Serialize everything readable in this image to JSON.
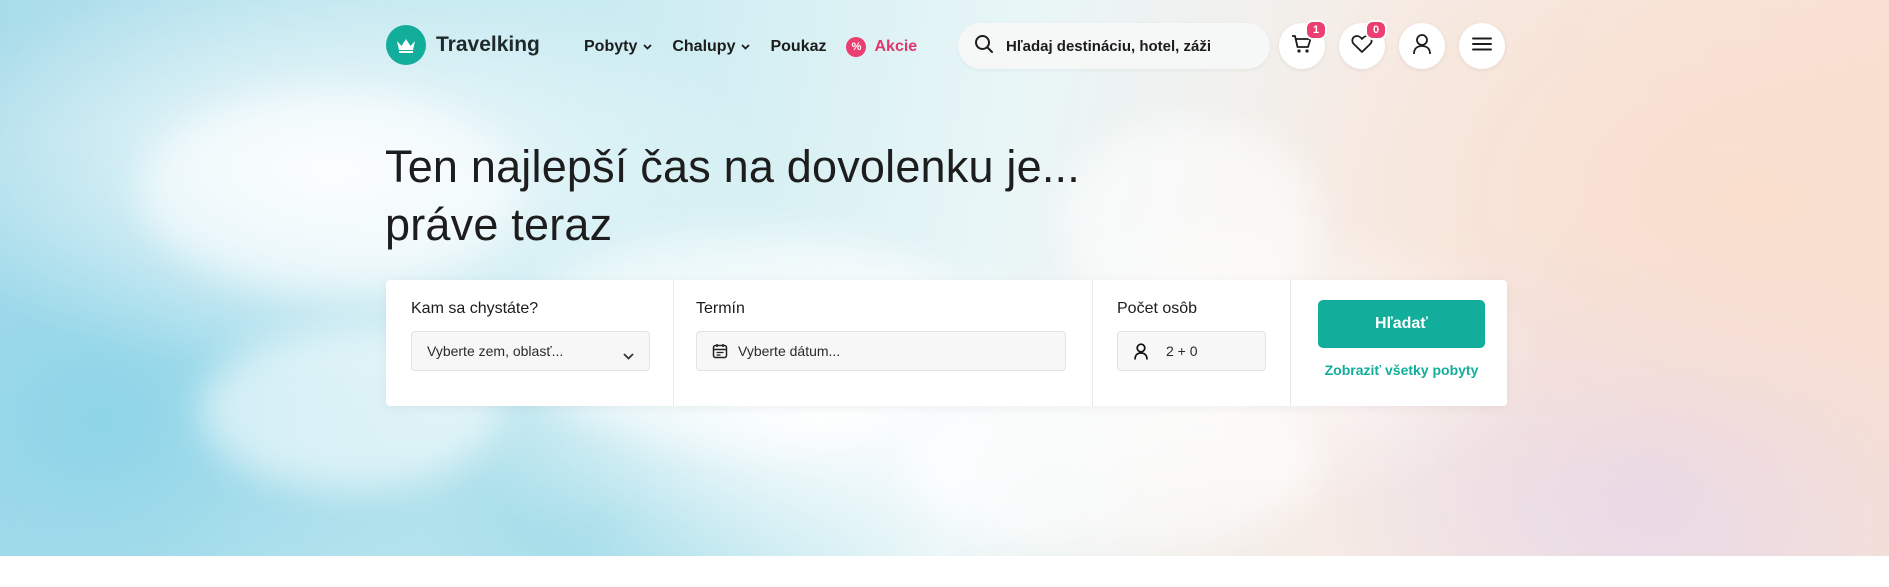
{
  "brand": {
    "name": "Travelking",
    "accent_color": "#12ad9b",
    "promo_color": "#ea3f70"
  },
  "nav": {
    "items": [
      {
        "label": "Pobyty",
        "has_dropdown": true
      },
      {
        "label": "Chalupy",
        "has_dropdown": true
      },
      {
        "label": "Poukaz",
        "has_dropdown": false
      }
    ],
    "promo": {
      "label": "Akcie",
      "icon": "percent-icon"
    }
  },
  "search": {
    "placeholder": "Hľadaj destináciu, hotel, záži",
    "icon": "search-icon"
  },
  "toolbar": {
    "cart": {
      "icon": "cart-icon",
      "count": "1"
    },
    "favorites": {
      "icon": "heart-icon",
      "count": "0"
    },
    "account": {
      "icon": "user-icon"
    },
    "menu": {
      "icon": "hamburger-menu-icon"
    }
  },
  "hero": {
    "headline_line1": "Ten najlepší čas na dovolenku je...",
    "headline_line2": "práve teraz"
  },
  "search_panel": {
    "destination": {
      "label": "Kam sa chystáte?",
      "placeholder": "Vyberte zem, oblasť..."
    },
    "date": {
      "label": "Termín",
      "placeholder": "Vyberte dátum..."
    },
    "persons": {
      "label": "Počet osôb",
      "value": "2 + 0"
    },
    "submit_label": "Hľadať",
    "show_all_label": "Zobraziť všetky pobyty"
  }
}
